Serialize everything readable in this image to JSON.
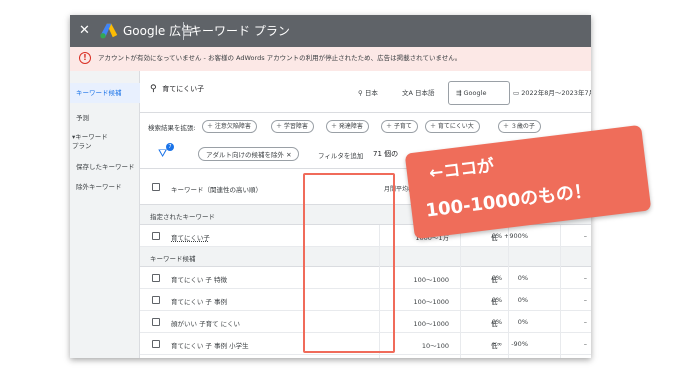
{
  "topbar": {
    "close_glyph": "✕",
    "product": "Google 広告",
    "page_title": "キーワード プラン"
  },
  "alert": {
    "icon": "!",
    "text": "アカウントが有効になっていません - お客様の AdWords アカウントの利用が停止されたため、広告は掲載されていません。"
  },
  "sidebar": {
    "items": [
      {
        "label": "キーワード候補",
        "active": true
      },
      {
        "label": "予測"
      },
      {
        "label": "▾キーワード\nプラン"
      },
      {
        "label": "保存したキーワード"
      },
      {
        "label": "除外キーワード"
      }
    ]
  },
  "search": {
    "query": "育てにくい子",
    "location": "日本",
    "language": "日本語",
    "engine": "Google",
    "date_range": "2022年8月～2023年7月"
  },
  "expand": {
    "label": "検索結果を拡張:",
    "chips": [
      "注意欠陥障害",
      "学習障害",
      "発達障害",
      "子育て",
      "育てにくい大",
      "３歳の子"
    ]
  },
  "filters": {
    "badge": "7",
    "chip": "アダルト向けの候補を除外",
    "add_filter": "フィルタを追加",
    "count": "71 個の",
    "trailing": "す"
  },
  "table": {
    "headers": {
      "keyword": "キーワード（関連性の高い順）",
      "volume": "月間平均検索ボリューム",
      "col3": "3か"
    },
    "section_specified": "指定されたキーワード",
    "section_candidates": "キーワード候補",
    "specified_rows": [
      {
        "keyword": "育てにくい子",
        "volume": "1000～1万",
        "c3": "0%",
        "c4": "+900%",
        "c5": "低",
        "c6": "–"
      }
    ],
    "candidate_rows": [
      {
        "keyword": "育てにくい 子 特徴",
        "volume": "100～1000",
        "c3": "0%",
        "c4": "0%",
        "c5": "低",
        "c6": "–"
      },
      {
        "keyword": "育てにくい 子 事例",
        "volume": "100～1000",
        "c3": "0%",
        "c4": "0%",
        "c5": "低",
        "c6": "–"
      },
      {
        "keyword": "顔がいい 子育て にくい",
        "volume": "100～1000",
        "c3": "0%",
        "c4": "0%",
        "c5": "低",
        "c6": "–"
      },
      {
        "keyword": "育てにくい 子 事例 小学生",
        "volume": "10～100",
        "c3": "+∞",
        "c4": "-90%",
        "c5": "低",
        "c6": "–"
      }
    ]
  },
  "callout": {
    "line1": "←ココが",
    "line2": "100-1000のもの！"
  },
  "colors": {
    "topbar": "#5f6368",
    "alert_bg": "#fce8e6",
    "accent": "#1a73e8",
    "callout": "#ef6d5a"
  }
}
